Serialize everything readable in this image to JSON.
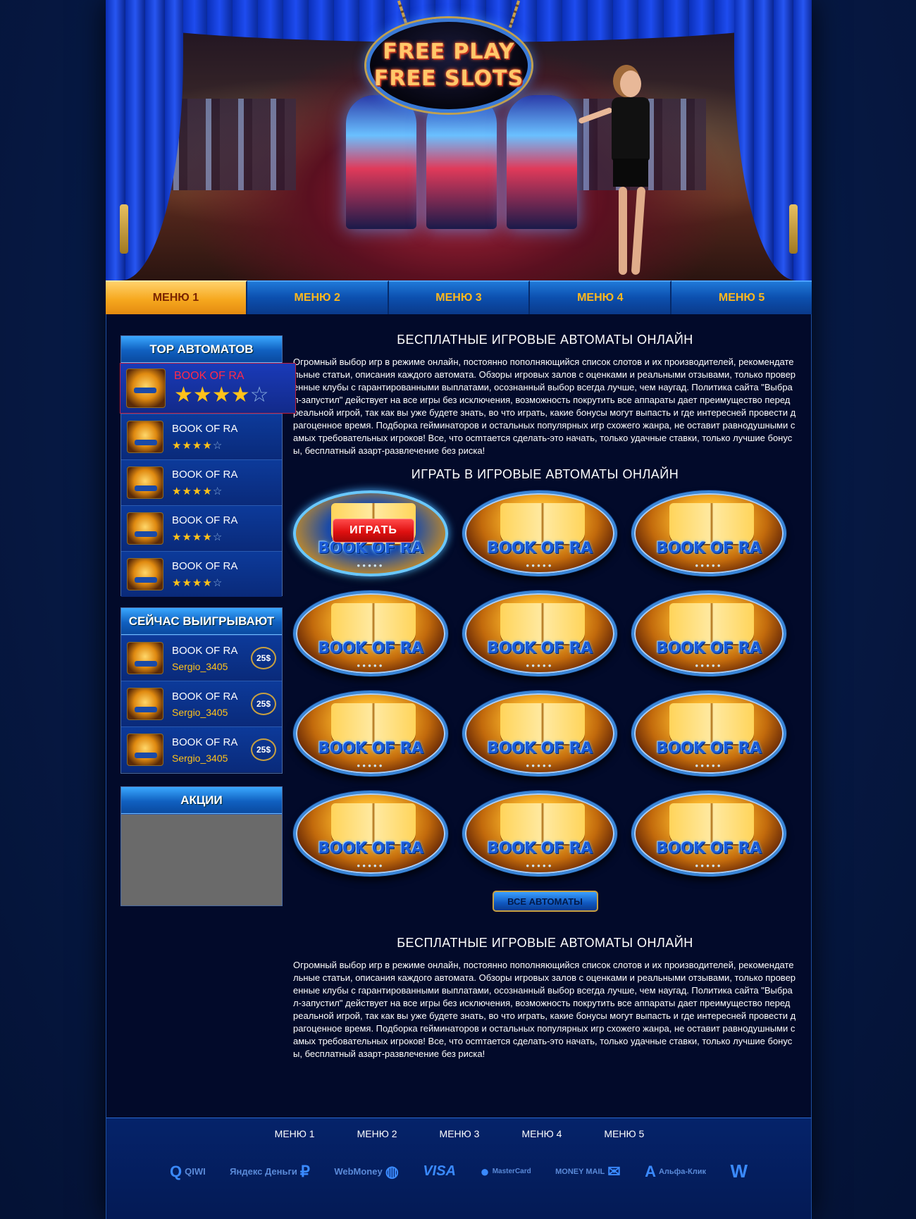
{
  "logo": {
    "line1": "FREE PLAY",
    "line2": "FREE SLOTS"
  },
  "nav": [
    "МЕНЮ 1",
    "МЕНЮ 2",
    "МЕНЮ 3",
    "МЕНЮ 4",
    "МЕНЮ 5"
  ],
  "sidebar": {
    "top_title": "TOP АВТОМАТОВ",
    "top_items": [
      {
        "name": "BOOK OF RA",
        "rating": 4
      },
      {
        "name": "BOOK OF RA",
        "rating": 4
      },
      {
        "name": "BOOK OF RA",
        "rating": 4
      },
      {
        "name": "BOOK OF RA",
        "rating": 4
      },
      {
        "name": "BOOK OF RA",
        "rating": 4
      }
    ],
    "winners_title": "СЕЙЧАС ВЫИГРЫВАЮТ",
    "winners": [
      {
        "game": "BOOK OF RA",
        "user": "Sergio_3405",
        "prize": "25$"
      },
      {
        "game": "BOOK OF RA",
        "user": "Sergio_3405",
        "prize": "25$"
      },
      {
        "game": "BOOK OF RA",
        "user": "Sergio_3405",
        "prize": "25$"
      }
    ],
    "promo_title": "АКЦИИ"
  },
  "main": {
    "heading1": "БЕСПЛАТНЫЕ ИГРОВЫЕ АВТОМАТЫ ОНЛАЙН",
    "text1": "Огромный выбор игр в режиме онлайн, постоянно пополняющийся список слотов и их производителей, рекомендательные статьи, описания каждого автомата. Обзоры игровых залов с оценками и реальными отзывами, только проверенные клубы с гарантированными выплатами, осознанный выбор всегда лучше, чем наугад. Политика сайта \"Выбрал-запустил\" действует на все игры без исключения, возможность покрутить все аппараты дает преимущество перед реальной игрой, так как вы уже будете знать, во что играть, какие  бонусы могут выпасть и где интересней провести драгоценное время. Подборка гейминаторов и остальных популярных игр схожего жанра, не оставит равнодушными самых требовательных игроков! Все, что осmтается сделать-это начать, только удачные ставки, только лучшие бонусы, бесплатный азарт-развлечение без риска!",
    "heading2": "ИГРАТЬ В ИГРОВЫЕ АВТОМАТЫ ОНЛАЙН",
    "play_label": "ИГРАТЬ",
    "games": [
      "BOOK OF RA",
      "BOOK OF RA",
      "BOOK OF RA",
      "BOOK OF RA",
      "BOOK OF RA",
      "BOOK OF RA",
      "BOOK OF RA",
      "BOOK OF RA",
      "BOOK OF RA",
      "BOOK OF RA",
      "BOOK OF RA",
      "BOOK OF RA"
    ],
    "all_button": "ВСЕ АВТОМАТЫ",
    "heading3": "БЕСПЛАТНЫЕ ИГРОВЫЕ АВТОМАТЫ ОНЛАЙН",
    "text2": "Огромный выбор игр в режиме онлайн, постоянно пополняющийся список слотов и их производителей, рекомендательные статьи, описания каждого автомата. Обзоры игровых залов с оценками и реальными отзывами, только проверенные клубы с гарантированными выплатами, осознанный выбор всегда лучше, чем наугад. Политика сайта \"Выбрал-запустил\" действует на все игры без исключения, возможность покрутить все аппараты дает преимущество перед реальной игрой, так как вы уже будете знать, во что играть, какие  бонусы могут выпасть и где интересней провести драгоценное время. Подборка гейминаторов и остальных популярных игр схожего жанра, не оставит равнодушными самых требовательных игроков! Все, что осmтается сделать-это начать, только удачные ставки, только лучшие бонусы, бесплатный азарт-развлечение без риска!"
  },
  "footer": {
    "nav": [
      "МЕНЮ 1",
      "МЕНЮ 2",
      "МЕНЮ 3",
      "МЕНЮ 4",
      "МЕНЮ 5"
    ],
    "payments": [
      {
        "label": "QIWI",
        "icon": "qiwi-icon",
        "glyph": "Q"
      },
      {
        "label": "Яндекс Деньги",
        "icon": "yandex-money-icon",
        "glyph": "₽"
      },
      {
        "label": "WebMoney",
        "icon": "webmoney-icon",
        "glyph": "◍"
      },
      {
        "label": "VISA",
        "icon": "visa-icon",
        "glyph": ""
      },
      {
        "label": "MasterCard",
        "icon": "mastercard-icon",
        "glyph": "●"
      },
      {
        "label": "MONEY MAIL",
        "icon": "moneymail-icon",
        "glyph": "✉"
      },
      {
        "label": "Альфа-Клик",
        "icon": "alfa-click-icon",
        "glyph": "A"
      },
      {
        "label": "",
        "icon": "w1-icon",
        "glyph": "W"
      }
    ]
  },
  "colors": {
    "nav_active": "#f6a81e",
    "nav_text": "#ffb81c",
    "star": "#ffc21a",
    "highlight_name": "#ff2a4a",
    "winner": "#ffc21a"
  }
}
